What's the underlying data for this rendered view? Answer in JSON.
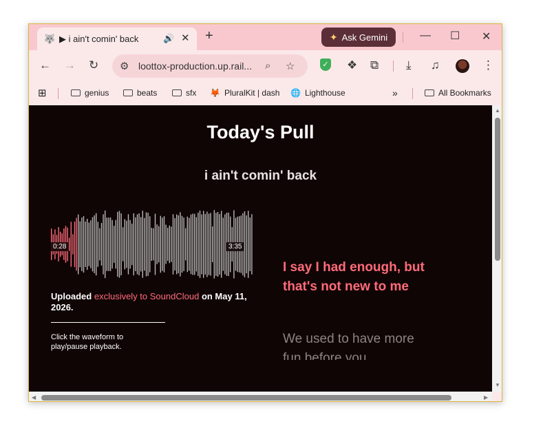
{
  "tab": {
    "title": "▶ i ain't comin' back"
  },
  "gemini": {
    "label": "Ask Gemini"
  },
  "address": {
    "url": "loottox-production.up.rail..."
  },
  "bookmarks": [
    {
      "label": "genius"
    },
    {
      "label": "beats"
    },
    {
      "label": "sfx"
    },
    {
      "label": "PluralKit | dash"
    },
    {
      "label": "Lighthouse"
    }
  ],
  "all_bookmarks": "All Bookmarks",
  "page": {
    "title": "Today's Pull",
    "track_title": "i ain't comin' back",
    "time_current": "0:28",
    "time_total": "3:35",
    "uploaded_prefix": "Uploaded ",
    "uploaded_link": "exclusively to SoundCloud",
    "uploaded_suffix": " on May 11, 2026.",
    "hint": "Click the waveform to play/pause playback.",
    "lyric_active": "I say I had enough, but that's not new to me",
    "lyric_next": "We used to have more fun before you"
  },
  "colors": {
    "accent": "#ff6b7a",
    "page_bg": "#100505",
    "wave_unplayed": "#b8b8b8"
  },
  "playback": {
    "progress_fraction": 0.13
  }
}
